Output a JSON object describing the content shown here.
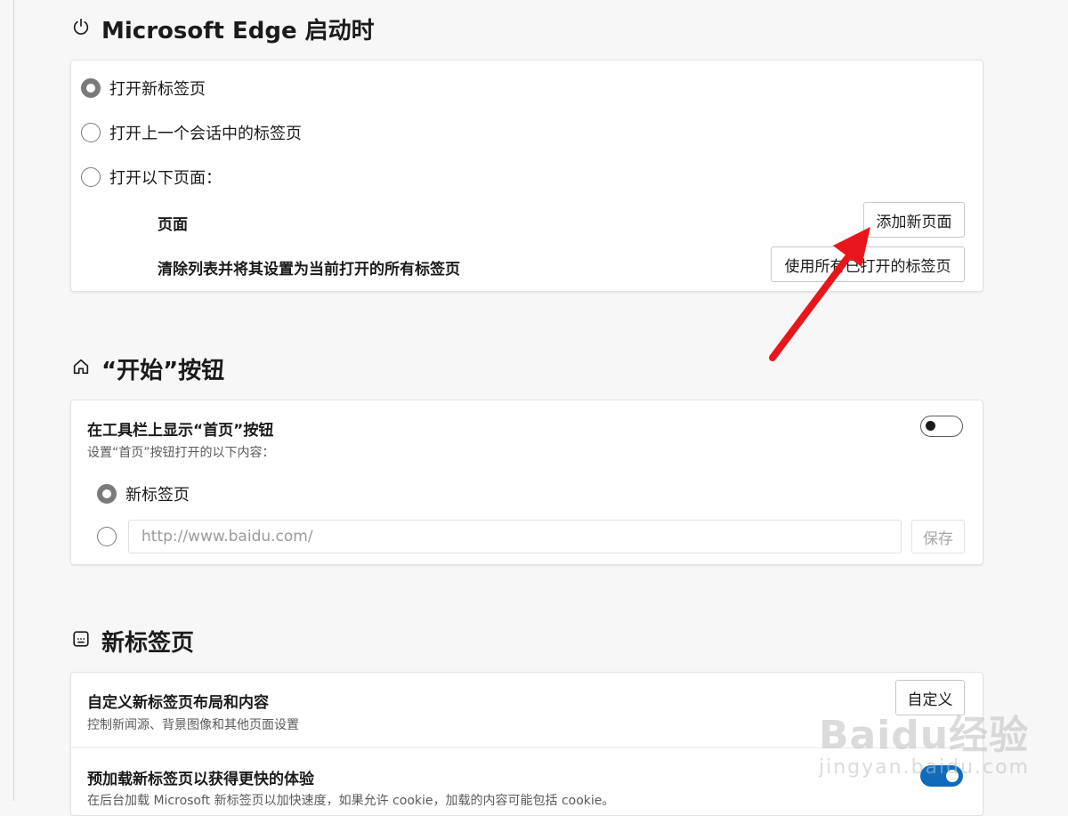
{
  "startup": {
    "title": "Microsoft Edge 启动时",
    "options": [
      {
        "label": "打开新标签页",
        "selected": true
      },
      {
        "label": "打开上一个会话中的标签页",
        "selected": false
      },
      {
        "label": "打开以下页面：",
        "selected": false
      }
    ],
    "pages_label": "页面",
    "add_page_button": "添加新页面",
    "clear_list_label": "清除列表并将其设置为当前打开的所有标签页",
    "use_all_tabs_button": "使用所有已打开的标签页"
  },
  "start_button": {
    "title": "“开始”按钮",
    "show_home_label": "在工具栏上显示“首页”按钮",
    "show_home_enabled": false,
    "home_desc": "设置“首页”按钮打开的以下内容：",
    "new_tab_option": "新标签页",
    "new_tab_selected": true,
    "url_placeholder": "http://www.baidu.com/",
    "save_button": "保存"
  },
  "new_tab": {
    "title": "新标签页",
    "customize_label": "自定义新标签页布局和内容",
    "customize_desc": "控制新闻源、背景图像和其他页面设置",
    "customize_button": "自定义",
    "preload_label": "预加载新标签页以获得更快的体验",
    "preload_enabled": true,
    "preload_desc": "在后台加载 Microsoft 新标签页以加快速度，如果允许 cookie，加载的内容可能包括 cookie。"
  },
  "watermark": {
    "brand": "Baidu经验",
    "url": "jingyan.baidu.com"
  },
  "colors": {
    "accent": "#0f6cbd",
    "annotation_arrow": "#e8161b",
    "radio": "#7a7a7a"
  },
  "icons": {
    "startup": "power-icon",
    "start_button": "home-icon",
    "new_tab": "new-tab-icon"
  }
}
